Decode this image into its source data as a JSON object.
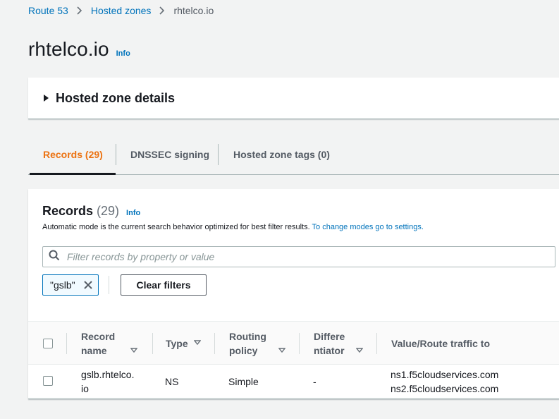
{
  "breadcrumb": {
    "items": [
      "Route 53",
      "Hosted zones"
    ],
    "current": "rhtelco.io"
  },
  "page": {
    "title": "rhtelco.io",
    "info_label": "Info"
  },
  "zone_details": {
    "label": "Hosted zone details"
  },
  "tabs": [
    {
      "label": "Records (29)",
      "active": true
    },
    {
      "label": "DNSSEC signing",
      "active": false
    },
    {
      "label": "Hosted zone tags (0)",
      "active": false
    }
  ],
  "records": {
    "title": "Records",
    "count": "(29)",
    "info_label": "Info",
    "description": "Automatic mode is the current search behavior optimized for best filter results.",
    "description_link": "To change modes go to settings.",
    "search_placeholder": "Filter records by property or value",
    "token": "\"gslb\"",
    "clear_filters": "Clear filters"
  },
  "table": {
    "columns": {
      "record_name_1": "Record",
      "record_name_2": "name",
      "type": "Type",
      "routing_1": "Routing",
      "routing_2": "policy",
      "diff_1": "Differe",
      "diff_2": "ntiator",
      "value": "Value/Route traffic to"
    },
    "rows": [
      {
        "name_1": "gslb.rhtelco.",
        "name_2": "io",
        "type": "NS",
        "routing": "Simple",
        "differentiator": "-",
        "value_1": "ns1.f5cloudservices.com",
        "value_2": "ns2.f5cloudservices.com"
      }
    ]
  },
  "colors": {
    "link": "#0073bb",
    "active_tab": "#ec7211",
    "background": "#f2f3f3"
  }
}
